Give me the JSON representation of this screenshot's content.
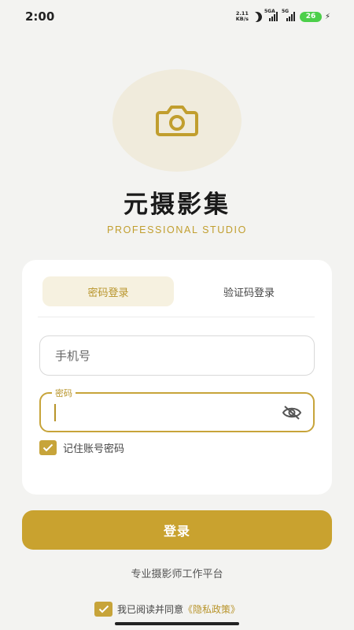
{
  "status_bar": {
    "time": "2:00",
    "net_speed_value": "2.11",
    "net_speed_unit": "KB/s",
    "sim1_label": "5GA",
    "sim2_label": "5G",
    "battery": "26"
  },
  "app": {
    "title": "元摄影集",
    "subtitle": "PROFESSIONAL STUDIO"
  },
  "login_card": {
    "tabs": [
      {
        "label": "密码登录",
        "active": true
      },
      {
        "label": "验证码登录",
        "active": false
      }
    ],
    "phone_placeholder": "手机号",
    "password_label": "密码",
    "password_value": "",
    "remember_label": "记住账号密码",
    "remember_checked": true
  },
  "login_button": "登录",
  "platform_text": "专业摄影师工作平台",
  "agreement": {
    "prefix": "我已阅读并同意",
    "policy_link": "《隐私政策》",
    "checked": true
  },
  "colors": {
    "accent": "#c9a22f",
    "accent_light": "#f6f1e0",
    "background": "#f3f3f1"
  }
}
